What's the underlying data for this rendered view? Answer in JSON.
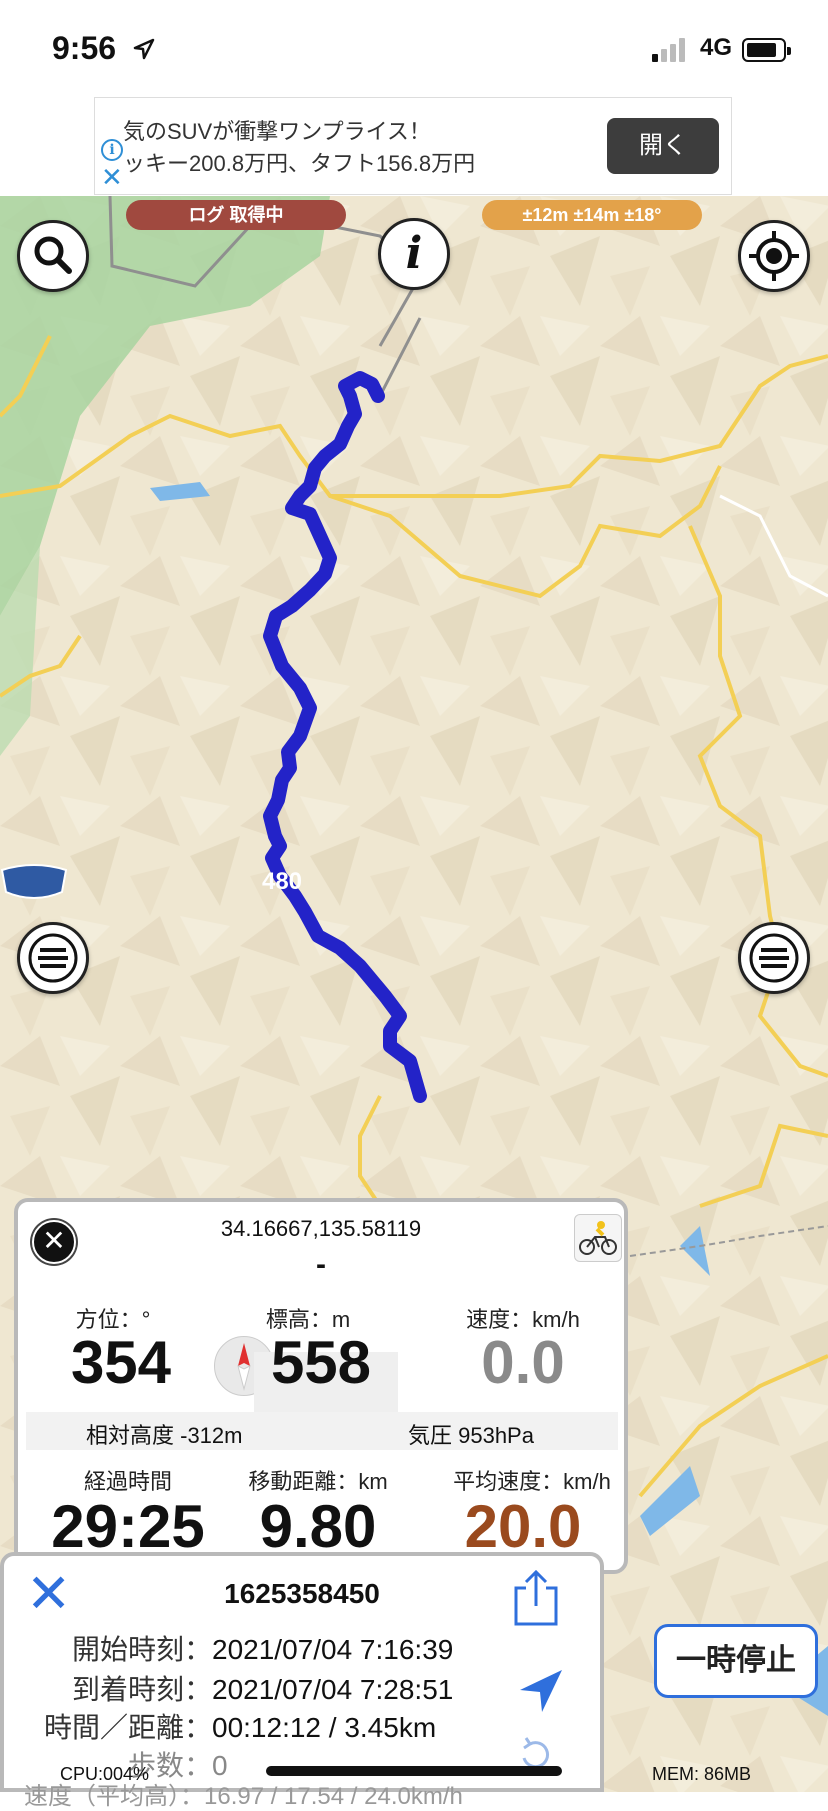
{
  "status_bar": {
    "time": "9:56",
    "network": "4G"
  },
  "ad": {
    "line1": "気のSUVが衝撃ワンプライス！",
    "line2": "ッキー200.8万円、タフト156.8万円",
    "open_label": "開く"
  },
  "map": {
    "log_badge": "ログ 取得中",
    "accuracy_badge": "±12m ±14m ±18°",
    "route_shield": "480"
  },
  "info_panel": {
    "coordinates": "34.16667,135.58119",
    "place": "-",
    "heading_label": "方位：°",
    "heading_value": "354",
    "altitude_label": "標高：m",
    "altitude_value": "558",
    "speed_label": "速度：km/h",
    "speed_value": "0.0",
    "relative_altitude": "相対高度 -312m",
    "pressure": "気圧 953hPa",
    "elapsed_label": "経過時間",
    "elapsed_value": "29:25",
    "distance_label": "移動距離：km",
    "distance_value": "9.80",
    "avg_speed_label": "平均速度：km/h",
    "avg_speed_value": "20.0"
  },
  "track_panel": {
    "id": "1625358450",
    "start_label": "開始時刻：",
    "start_value": "2021/07/04 7:16:39",
    "arrival_label": "到着時刻：",
    "arrival_value": "2021/07/04 7:28:51",
    "time_distance_label": "時間／距離：",
    "time_distance_value": "00:12:12 / 3.45km",
    "steps_label": "歩数：",
    "steps_value": "0",
    "speed_partial": "速度（平均高）：16.97 / 17.54 / 24.0km/h"
  },
  "pause_label": "一時停止",
  "cpu": "CPU:004%",
  "mem": "MEM: 86MB",
  "colors": {
    "track": "#2323c8",
    "road": "#f3cf55",
    "accent": "#2f6fdc",
    "avg_speed": "#9a4a1e"
  }
}
